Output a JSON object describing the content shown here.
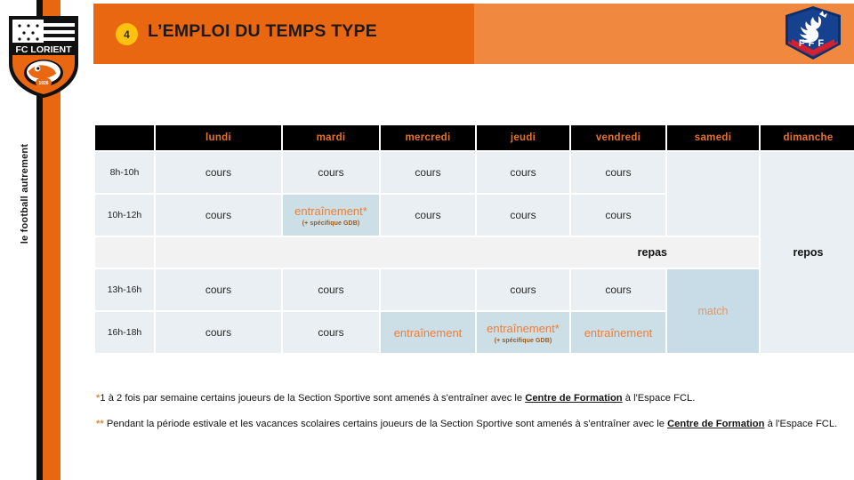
{
  "brand": {
    "club_name": "FC LORIENT",
    "crest_year": "1926",
    "tagline": "le football autrement",
    "federation_logo_text": "FFF",
    "accent_orange": "#ea6712",
    "header_orange_light": "#f0883f",
    "badge_yellow": "#ffc20e",
    "cell_blue": "#e9eff2",
    "training_blue": "#ccdee6",
    "meal_gray": "#f2f2f2",
    "day_header_bg": "#000000",
    "day_header_text": "#e8732a"
  },
  "header": {
    "section_number": "4",
    "title": "L’EMPLOI DU TEMPS TYPE"
  },
  "schedule": {
    "corner_label": "",
    "days": [
      "lundi",
      "mardi",
      "mercredi",
      "jeudi",
      "vendredi",
      "samedi",
      "dimanche"
    ],
    "times": [
      "8h-10h",
      "10h-12h",
      "13h-16h",
      "16h-18h"
    ],
    "meal_label": "repas",
    "rest_label": "repos",
    "match_label": "match",
    "row_8_10": {
      "time": "8h-10h",
      "lundi": "cours",
      "mardi": "cours",
      "mercredi": "cours",
      "jeudi": "cours",
      "vendredi": "cours"
    },
    "row_10_12": {
      "time": "10h-12h",
      "lundi": "cours",
      "mardi": "entraînement*",
      "mardi_sub": "(+ spécifique GDB)",
      "mercredi": "cours",
      "jeudi": "cours",
      "vendredi": "cours"
    },
    "row_13_16": {
      "time": "13h-16h",
      "lundi": "cours",
      "mardi": "cours",
      "mercredi": "",
      "jeudi": "cours",
      "vendredi": "cours"
    },
    "row_16_18": {
      "time": "16h-18h",
      "lundi": "cours",
      "mardi": "cours",
      "mercredi": "entraînement",
      "jeudi": "entraînement*",
      "jeudi_sub": "(+ spécifique GDB)",
      "vendredi": "entraînement"
    }
  },
  "footnotes": {
    "one_star": "*",
    "one_text_a": "1 à 2 fois par semaine certains joueurs de la Section Sportive sont amenés à s'entraîner avec le ",
    "one_link": "Centre de Formation",
    "one_text_b": " à l'Espace FCL.",
    "two_star": "**",
    "two_text_a": " Pendant la période estivale et les vacances scolaires certains joueurs de la Section Sportive sont amenés à s'entraîner avec le ",
    "two_link": "Centre de Formation",
    "two_text_b": " à l'Espace FCL."
  }
}
